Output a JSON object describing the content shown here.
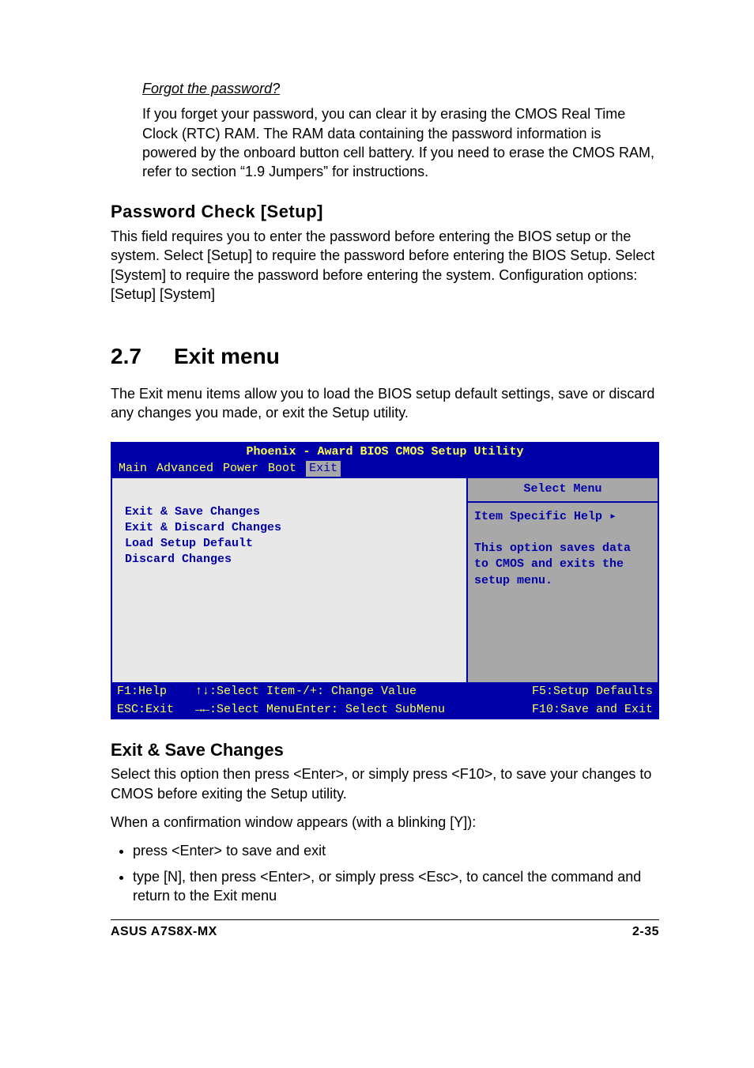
{
  "intro": {
    "forgot_heading": "Forgot the password?",
    "forgot_body": "If you forget your password, you can clear it by erasing the CMOS Real Time Clock (RTC) RAM. The RAM data containing the password information is powered by the onboard button cell battery. If you need to erase the CMOS RAM, refer to section “1.9 Jumpers” for instructions."
  },
  "password_check": {
    "heading": "Password Check [Setup]",
    "body": "This field requires you to enter the password before entering the BIOS setup or the system. Select [Setup] to require the password before entering the BIOS Setup. Select [System] to require the password before entering the system. Configuration options: [Setup] [System]"
  },
  "exit_menu": {
    "section_number": "2.7",
    "section_title": "Exit menu",
    "intro": "The Exit menu items allow you to load the BIOS setup default settings, save or discard any changes you made, or exit the Setup utility."
  },
  "bios": {
    "title": "Phoenix - Award BIOS CMOS Setup Utility",
    "tabs": [
      "Main",
      "Advanced",
      "Power",
      "Boot",
      "Exit"
    ],
    "active_tab": "Exit",
    "items": [
      "Exit & Save Changes",
      "Exit & Discard Changes",
      "Load Setup Default",
      "Discard Changes"
    ],
    "help_title": "Select Menu",
    "help_line1": "Item Specific Help ▸",
    "help_body": "This option saves data to CMOS and exits the setup menu.",
    "footer": {
      "col1": "F1:Help    ↑↓:Select Item",
      "col2": "-/+: Change Value",
      "col3": "F5:Setup Defaults",
      "col1b": "ESC:Exit   →←:Select Menu",
      "col2b": "Enter: Select SubMenu",
      "col3b": "F10:Save and Exit"
    }
  },
  "exit_save": {
    "heading": "Exit & Save Changes",
    "body": "Select this option then press <Enter>, or simply press <F10>, to save your changes to CMOS before exiting the Setup utility.",
    "confirm_line": "When a confirmation window appears (with a blinking [Y]):",
    "bullets": [
      "press <Enter> to save and exit",
      "type [N], then press <Enter>, or simply press <Esc>, to cancel the command and return to the Exit menu"
    ]
  },
  "page_footer": {
    "left": "ASUS A7S8X-MX",
    "right": "2-35"
  }
}
